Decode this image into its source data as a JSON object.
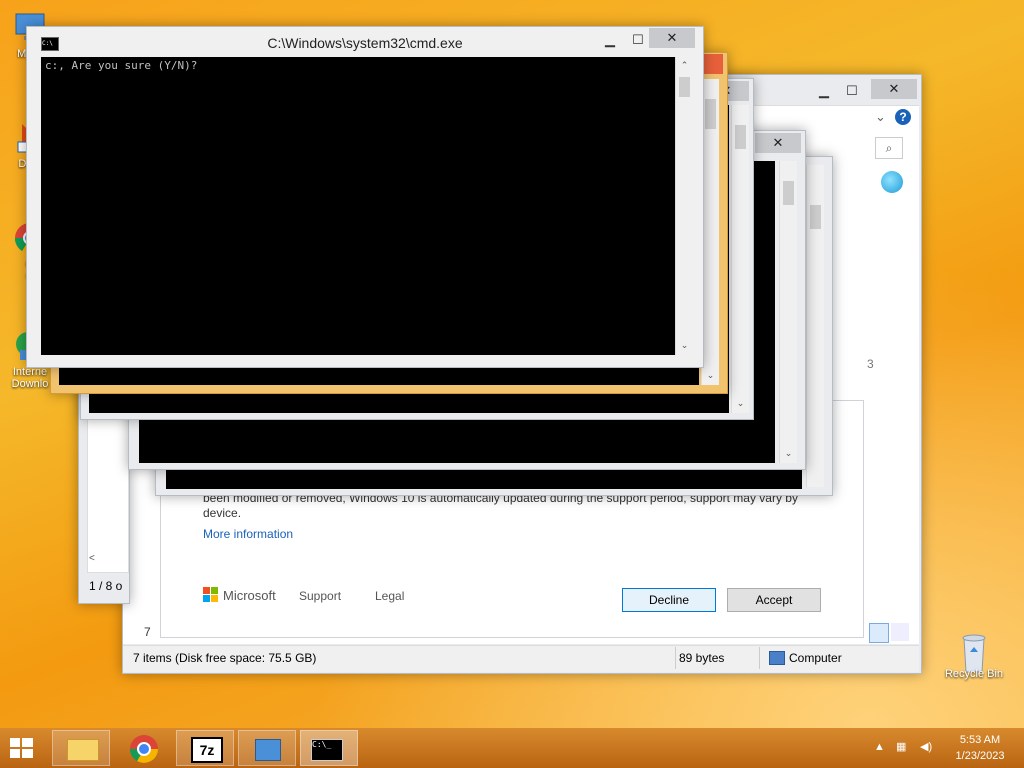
{
  "desktop": {
    "icons": [
      {
        "name": "my-computer",
        "label": "My C"
      },
      {
        "name": "data",
        "label": "Data"
      },
      {
        "name": "google-chrome",
        "label": "G\nC"
      },
      {
        "name": "internet-download-manager",
        "label": "Interne\nDownlo"
      },
      {
        "name": "recycle-bin",
        "label": "Recycle Bin"
      }
    ]
  },
  "cmd_front": {
    "title": "C:\\Windows\\system32\\cmd.exe",
    "prompt_text": "c:, Are you sure (Y/N)?",
    "min": "▁",
    "max": "☐",
    "close": "✕"
  },
  "explorer": {
    "status_items": "7 items (Disk free space: 75.5 GB)",
    "status_size": "89 bytes",
    "status_location": "Computer",
    "left_pane_count": "1 / 8 o",
    "left_number": "7",
    "number_3": "3",
    "min": "▁",
    "max": "☐",
    "close": "✕",
    "help": "?",
    "search": "⌕"
  },
  "license_dialog": {
    "body_text": "been modified or removed, Windows 10 is automatically updated during the support period, support may vary by device.",
    "more_info": "More information",
    "brand": "Microsoft",
    "support": "Support",
    "legal": "Legal",
    "decline": "Decline",
    "accept": "Accept"
  },
  "taskbar": {
    "items": [
      "start",
      "file-explorer",
      "chrome",
      "7zip",
      "installer",
      "cmd"
    ],
    "time": "5:53 AM",
    "date": "1/23/2023",
    "sevenzip_label": "7z"
  },
  "colors": {
    "accent_orange": "#f5a623",
    "taskbar": "#c8741a",
    "link": "#1a62b9"
  }
}
